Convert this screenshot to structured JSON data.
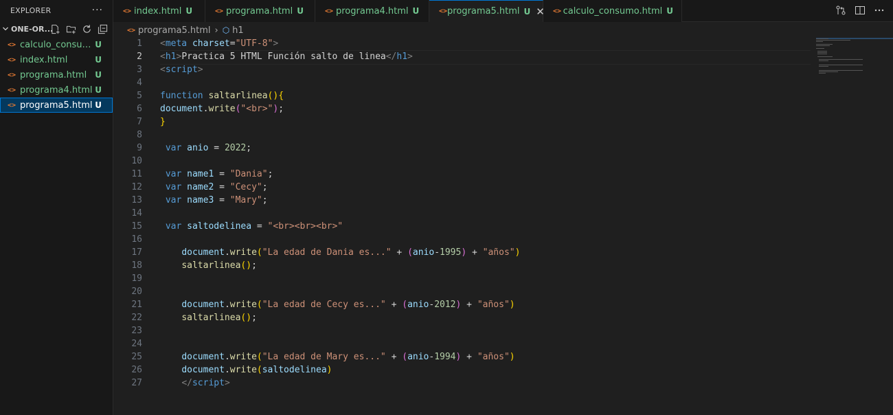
{
  "sidebar": {
    "title": "EXPLORER",
    "more": "···",
    "folder": "ONE-OR...",
    "files": [
      {
        "name": "calculo_consum...",
        "status": "U"
      },
      {
        "name": "index.html",
        "status": "U"
      },
      {
        "name": "programa.html",
        "status": "U"
      },
      {
        "name": "programa4.html",
        "status": "U"
      },
      {
        "name": "programa5.html",
        "status": "U",
        "active": true
      }
    ]
  },
  "tabs": [
    {
      "label": "index.html",
      "status": "U"
    },
    {
      "label": "programa.html",
      "status": "U"
    },
    {
      "label": "programa4.html",
      "status": "U"
    },
    {
      "label": "programa5.html",
      "status": "U",
      "active": true,
      "close": "✕"
    },
    {
      "label": "calculo_consumo.html",
      "status": "U"
    }
  ],
  "file_icon": "<>",
  "breadcrumb": {
    "file": "programa5.html",
    "symbol": "h1"
  },
  "editor": {
    "line_numbers": [
      "1",
      "2",
      "3",
      "4",
      "5",
      "6",
      "7",
      "8",
      "9",
      "10",
      "11",
      "12",
      "13",
      "14",
      "15",
      "16",
      "17",
      "18",
      "19",
      "20",
      "21",
      "22",
      "23",
      "24",
      "25",
      "26",
      "27"
    ],
    "current_line": 2
  },
  "colors": {
    "accent": "#0078d4",
    "untracked": "#73c991",
    "html_icon": "#e37933"
  }
}
